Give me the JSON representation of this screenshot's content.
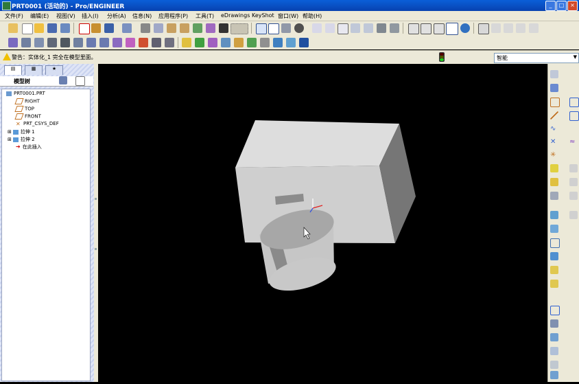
{
  "window": {
    "title": "PRT0001 (活动的) - Pro/ENGINEER",
    "buttons": {
      "minimize": "_",
      "maximize": "□",
      "close": "×"
    }
  },
  "menu": [
    "文件(F)",
    "编辑(E)",
    "视图(V)",
    "插入(I)",
    "分析(A)",
    "信息(N)",
    "应用程序(P)",
    "工具(T)",
    "eDrawings",
    "KeyShot",
    "窗口(W)",
    "帮助(H)"
  ],
  "message": {
    "text": "警告：实体化_1 完全在模型里面。"
  },
  "selection_filter": {
    "value": "智能"
  },
  "model_tree": {
    "tabs": [
      "模型树",
      "文件夹",
      "收藏夹"
    ],
    "header": "模型树",
    "items": [
      {
        "label": "PRT0001.PRT",
        "icon": "part-icon"
      },
      {
        "label": "RIGHT",
        "icon": "datum-plane-icon"
      },
      {
        "label": "TOP",
        "icon": "datum-plane-icon"
      },
      {
        "label": "FRONT",
        "icon": "datum-plane-icon"
      },
      {
        "label": "PRT_CSYS_DEF",
        "icon": "csys-icon"
      },
      {
        "label": "拉伸 1",
        "icon": "extrude-icon"
      },
      {
        "label": "拉伸 2",
        "icon": "extrude-icon"
      },
      {
        "label": "在此插入",
        "icon": "insert-here-icon"
      }
    ]
  },
  "colors": {
    "titlebar": "#0842b0",
    "chrome": "#ece9d8",
    "viewport_bg": "#000000",
    "model_light": "#d4d4d4",
    "model_mid": "#a8a8a8",
    "model_dark": "#6a6a6a"
  }
}
